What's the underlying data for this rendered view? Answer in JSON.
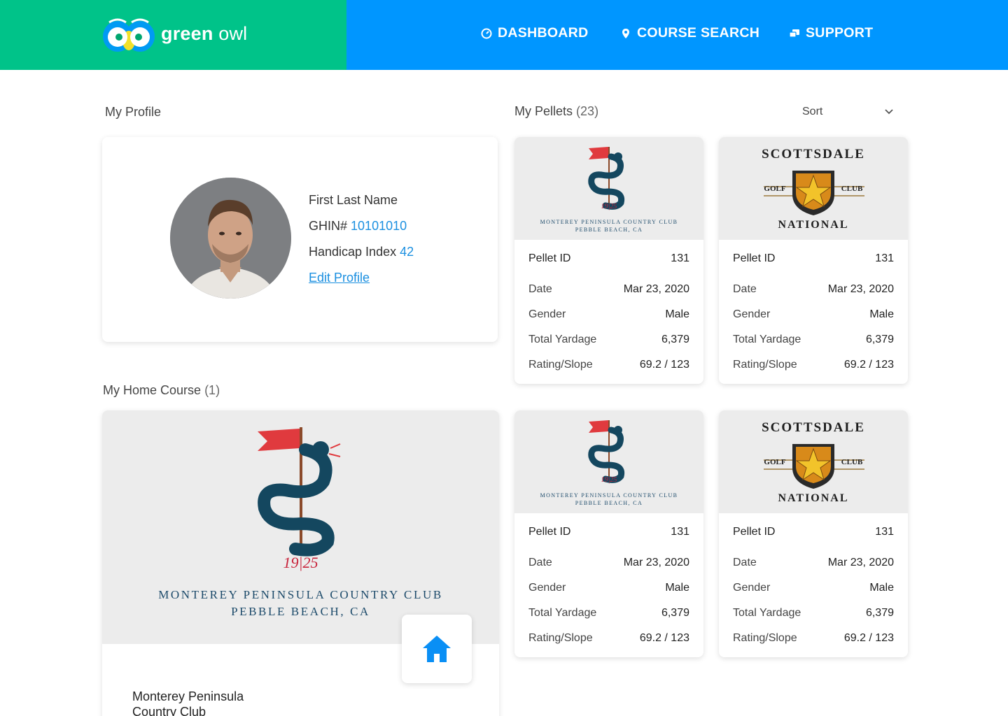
{
  "brand": {
    "name_bold": "green",
    "name_light": " owl",
    "colors": {
      "green": "#00c389",
      "blue": "#0096ff"
    }
  },
  "nav": {
    "items": [
      {
        "label": "DASHBOARD",
        "icon": "gauge-icon"
      },
      {
        "label": "COURSE SEARCH",
        "icon": "location-pin-icon"
      },
      {
        "label": "SUPPORT",
        "icon": "chat-icon"
      }
    ]
  },
  "profile": {
    "title": "My Profile",
    "name": "First Last Name",
    "ghin_label": "GHIN#",
    "ghin_value": "10101010",
    "handicap_label": "Handicap Index",
    "handicap_value": "42",
    "edit_label": "Edit Profile"
  },
  "pellets": {
    "title": "My Pellets",
    "count": "(23)",
    "sort_label": "Sort",
    "cards": [
      {
        "logo": "monterey",
        "id_label": "Pellet ID",
        "id": "131",
        "date_label": "Date",
        "date": "Mar 23, 2020",
        "gender_label": "Gender",
        "gender": "Male",
        "yardage_label": "Total Yardage",
        "yardage": "6,379",
        "rating_label": "Rating/Slope",
        "rating": "69.2 / 123"
      },
      {
        "logo": "scottsdale",
        "id_label": "Pellet ID",
        "id": "131",
        "date_label": "Date",
        "date": "Mar 23, 2020",
        "gender_label": "Gender",
        "gender": "Male",
        "yardage_label": "Total Yardage",
        "yardage": "6,379",
        "rating_label": "Rating/Slope",
        "rating": "69.2 / 123"
      },
      {
        "logo": "monterey",
        "id_label": "Pellet ID",
        "id": "131",
        "date_label": "Date",
        "date": "Mar 23, 2020",
        "gender_label": "Gender",
        "gender": "Male",
        "yardage_label": "Total Yardage",
        "yardage": "6,379",
        "rating_label": "Rating/Slope",
        "rating": "69.2 / 123"
      },
      {
        "logo": "scottsdale",
        "id_label": "Pellet ID",
        "id": "131",
        "date_label": "Date",
        "date": "Mar 23, 2020",
        "gender_label": "Gender",
        "gender": "Male",
        "yardage_label": "Total Yardage",
        "yardage": "6,379",
        "rating_label": "Rating/Slope",
        "rating": "69.2 / 123"
      }
    ]
  },
  "clubs": {
    "monterey": {
      "year_left": "19",
      "year_right": "25",
      "line1": "MONTEREY PENINSULA COUNTRY CLUB",
      "line2": "PEBBLE BEACH, CA"
    },
    "scottsdale": {
      "top": "SCOTTSDALE",
      "left": "GOLF",
      "right": "CLUB",
      "bottom": "NATIONAL"
    }
  },
  "home": {
    "title": "My Home Course",
    "count": "(1)",
    "name": "Monterey Peninsula Country Club",
    "button_icon": "home-icon"
  }
}
